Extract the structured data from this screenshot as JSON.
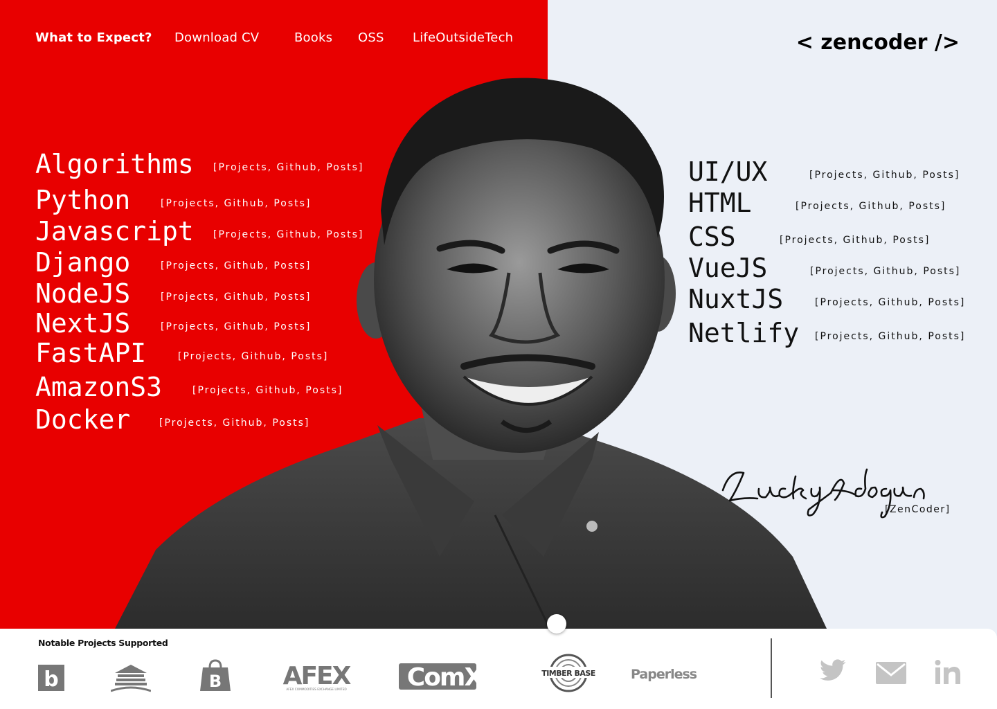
{
  "nav": {
    "items": [
      "What to Expect?",
      "Download CV",
      "Books",
      "OSS",
      "LifeOutsideTech"
    ]
  },
  "brand": "< zencoder />",
  "skills_left": [
    {
      "name": "Algorithms",
      "links": "[Projects, Github, Posts]"
    },
    {
      "name": "Python",
      "links": "[Projects, Github, Posts]"
    },
    {
      "name": "Javascript",
      "links": "[Projects, Github, Posts]"
    },
    {
      "name": "Django",
      "links": "[Projects, Github, Posts]"
    },
    {
      "name": "NodeJS",
      "links": "[Projects, Github, Posts]"
    },
    {
      "name": "NextJS",
      "links": "[Projects, Github, Posts]"
    },
    {
      "name": "FastAPI",
      "links": "[Projects, Github, Posts]"
    },
    {
      "name": "AmazonS3",
      "links": "[Projects, Github, Posts]"
    },
    {
      "name": "Docker",
      "links": "[Projects, Github, Posts]"
    }
  ],
  "skills_right": [
    {
      "name": "UI/UX",
      "links": "[Projects, Github, Posts]"
    },
    {
      "name": "HTML",
      "links": "[Projects, Github, Posts]"
    },
    {
      "name": "CSS",
      "links": "[Projects, Github, Posts]"
    },
    {
      "name": "VueJS",
      "links": "[Projects, Github, Posts]"
    },
    {
      "name": "NuxtJS",
      "links": "[Projects, Github, Posts]"
    },
    {
      "name": "Netlify",
      "links": "[Projects, Github, Posts]"
    }
  ],
  "signature": {
    "handwriting": "LuckyAdogun",
    "tag": "[ZenCoder]"
  },
  "footer": {
    "title": "Notable Projects Supported",
    "logos": [
      {
        "icon": "b-square-logo",
        "text": "b"
      },
      {
        "icon": "building-logo",
        "text": ""
      },
      {
        "icon": "shopping-bag-logo",
        "text": "B"
      },
      {
        "icon": "afex-logo",
        "text": "AFEX",
        "subtext": "AFEX COMMODITIES EXCHANGE LIMITED"
      },
      {
        "icon": "comx-logo",
        "text": "ComX"
      },
      {
        "icon": "timber-base-logo",
        "text": "TIMBER BASE"
      },
      {
        "icon": "paperless-logo",
        "text": "Paperless"
      }
    ],
    "social": [
      "twitter-icon",
      "mail-icon",
      "linkedin-icon"
    ]
  },
  "colors": {
    "accent": "#e80000",
    "background": "#ecf0f7",
    "logo_gray": "#777777",
    "social_gray": "#c4c4c4"
  }
}
